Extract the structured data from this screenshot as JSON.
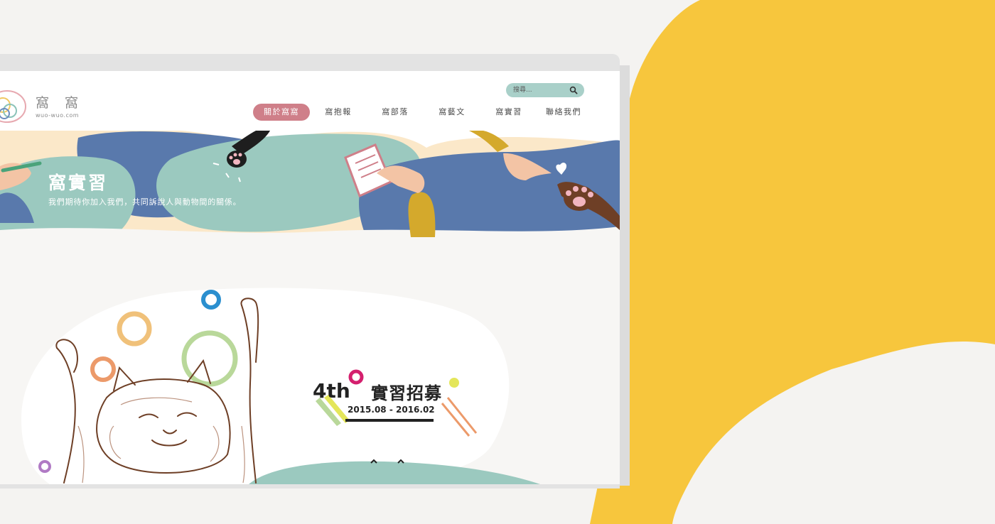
{
  "colors": {
    "accent_yellow": "#f7c63d",
    "nav_active": "#cf7f89",
    "search_bg": "#a9d0c9",
    "banner_blue": "#5979ac",
    "banner_teal": "#9bc9bf",
    "banner_cream": "#fbe8c9"
  },
  "logo": {
    "title": "窩 窩",
    "subtitle": "wuo-wuo.com"
  },
  "search": {
    "placeholder": "搜尋...",
    "icon": "search-icon"
  },
  "nav": {
    "items": [
      {
        "label": "關於窩窩",
        "active": true
      },
      {
        "label": "窩抱報",
        "active": false
      },
      {
        "label": "窩部落",
        "active": false
      },
      {
        "label": "窩藝文",
        "active": false
      },
      {
        "label": "窩實習",
        "active": false
      },
      {
        "label": "聯絡我們",
        "active": false
      }
    ]
  },
  "banner": {
    "title": "窩實習",
    "subtitle": "我們期待你加入我們，共同訴說人與動物間的關係。"
  },
  "recruit": {
    "edition": "4th",
    "title": "實習招募",
    "dates": "2015.08 - 2016.02"
  }
}
